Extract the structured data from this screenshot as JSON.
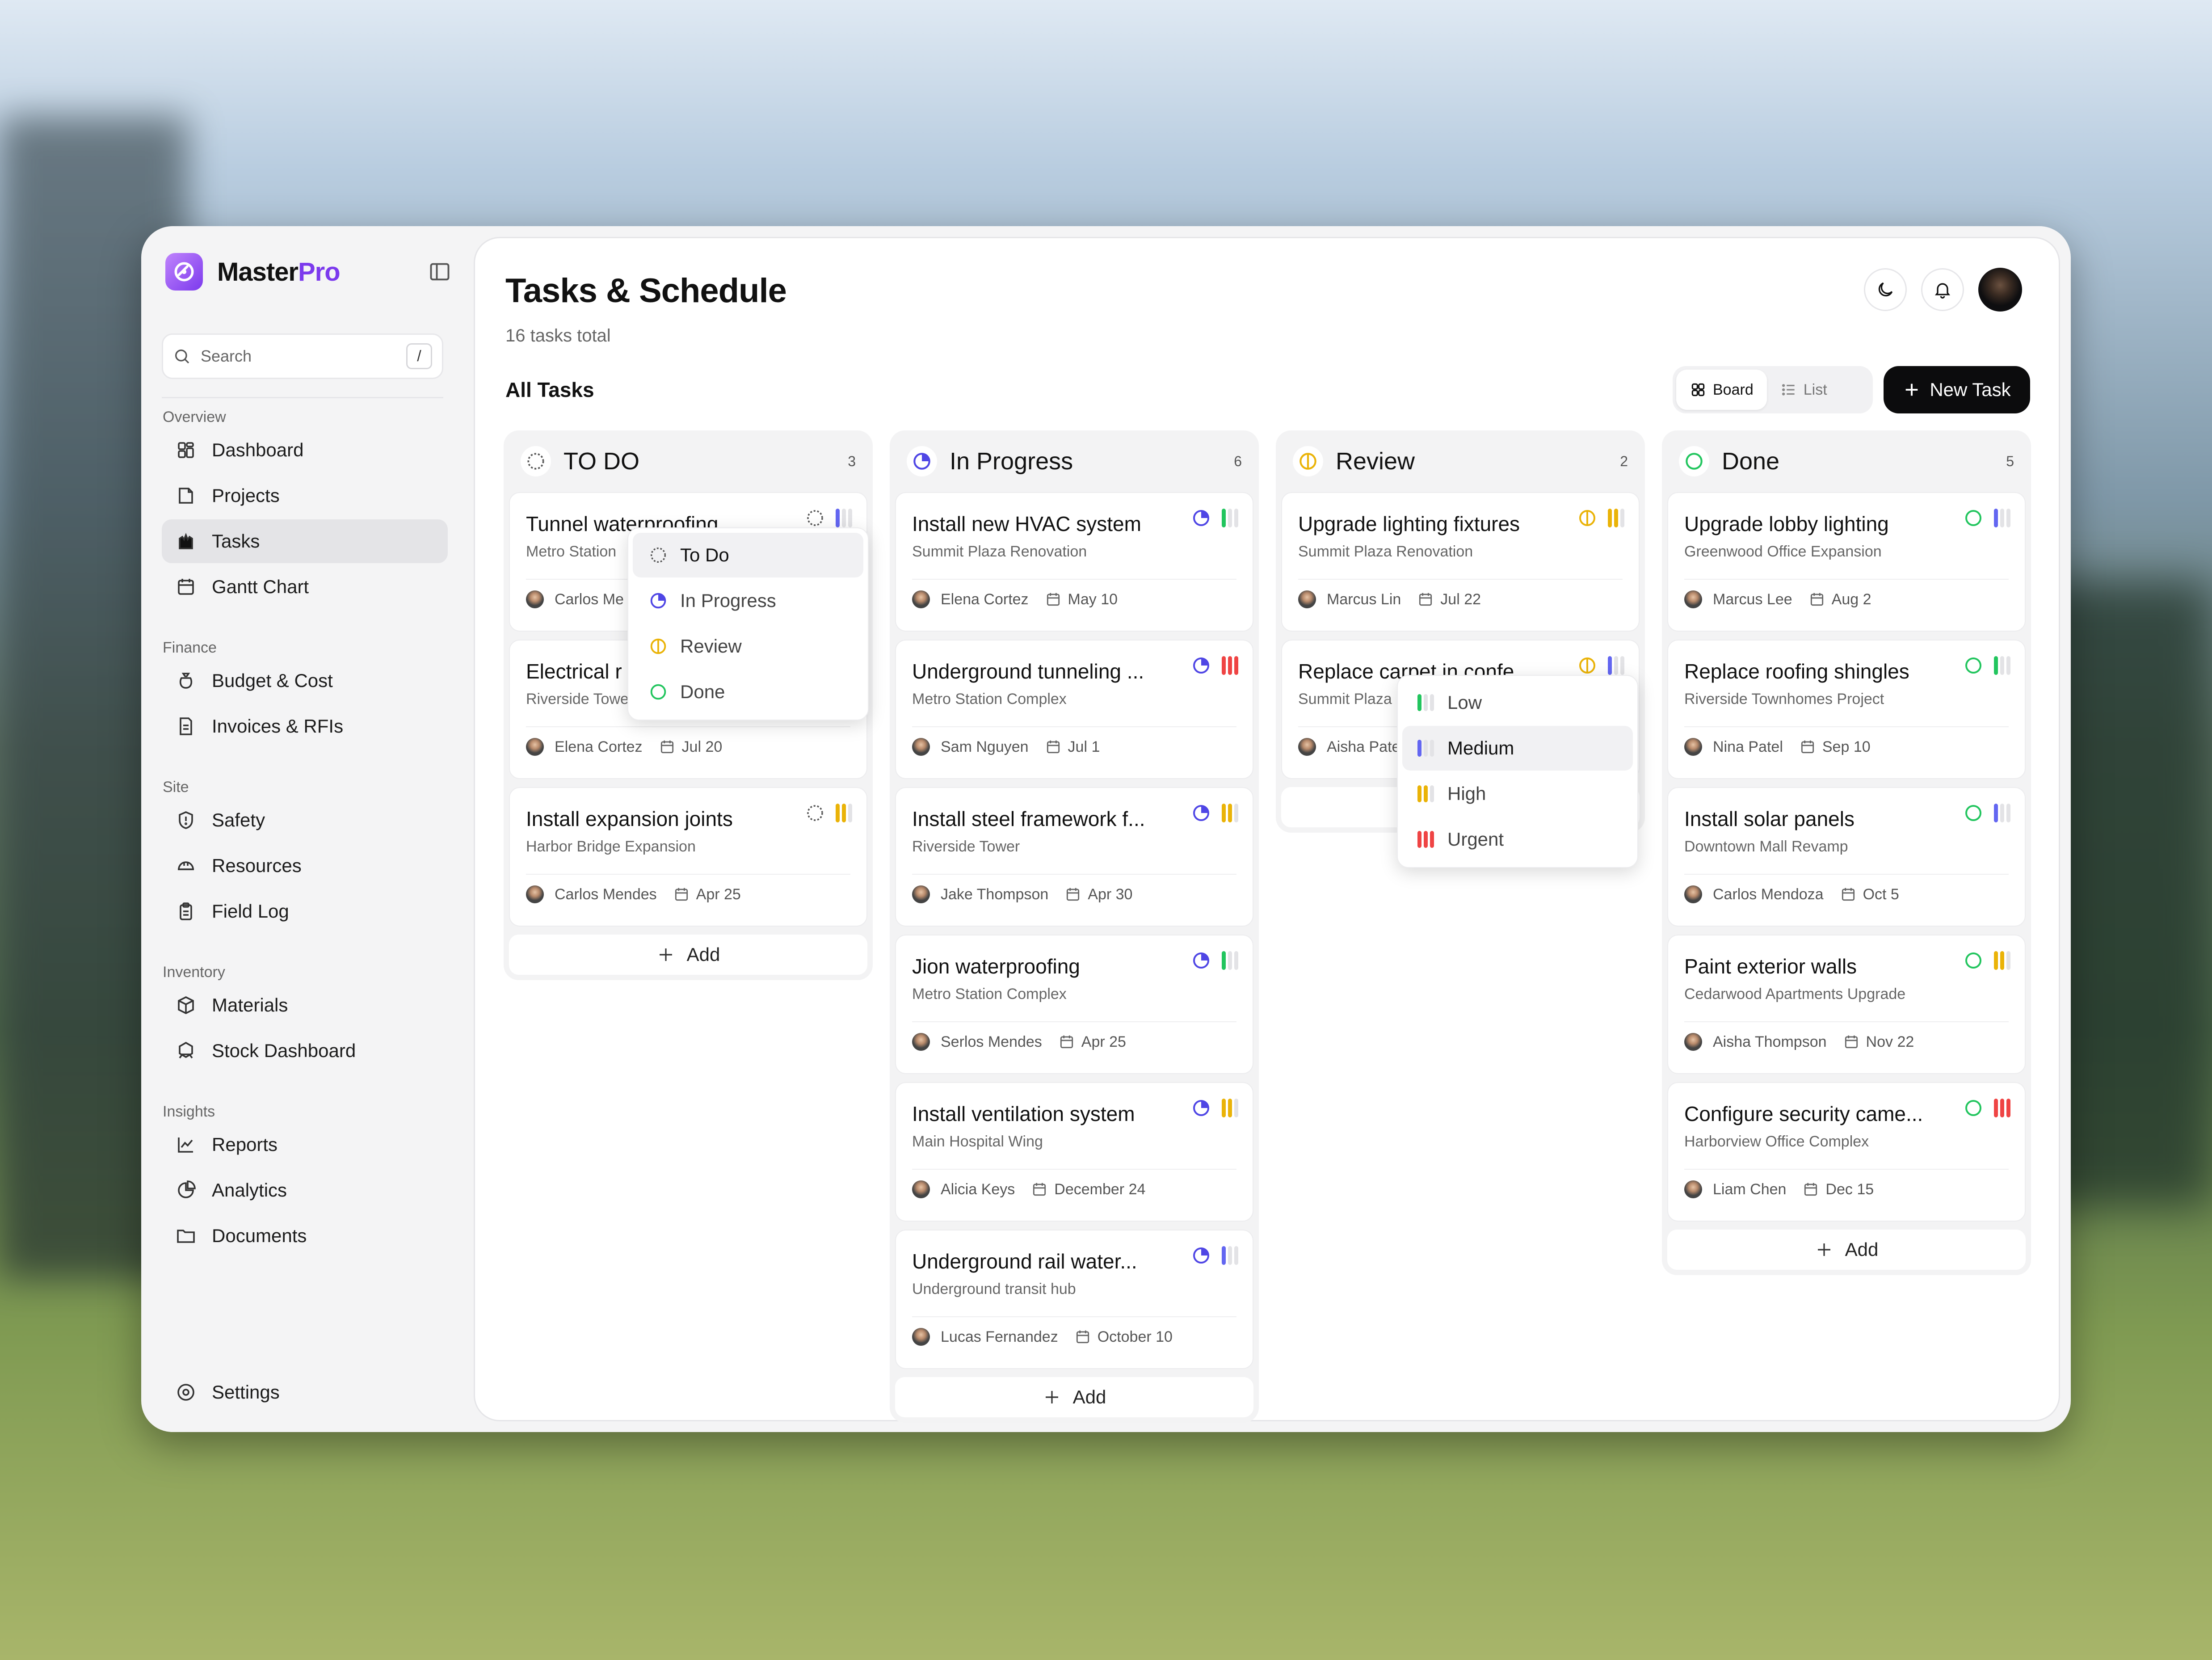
{
  "app": {
    "brand_main": "Master",
    "brand_accent": "Pro",
    "accent_color": "#7c3aed"
  },
  "search": {
    "placeholder": "Search",
    "shortcut": "/"
  },
  "nav": [
    {
      "section": "Overview",
      "items": [
        {
          "label": "Dashboard",
          "icon": "dashboard-icon"
        },
        {
          "label": "Projects",
          "icon": "projects-icon"
        },
        {
          "label": "Tasks",
          "icon": "tasks-icon",
          "active": true
        },
        {
          "label": "Gantt Chart",
          "icon": "calendar-icon"
        }
      ]
    },
    {
      "section": "Finance",
      "items": [
        {
          "label": "Budget & Cost",
          "icon": "money-bag-icon"
        },
        {
          "label": "Invoices & RFIs",
          "icon": "document-icon"
        }
      ]
    },
    {
      "section": "Site",
      "items": [
        {
          "label": "Safety",
          "icon": "shield-alert-icon"
        },
        {
          "label": "Resources",
          "icon": "helmet-icon"
        },
        {
          "label": "Field Log",
          "icon": "clipboard-icon"
        }
      ]
    },
    {
      "section": "Inventory",
      "items": [
        {
          "label": "Materials",
          "icon": "box-icon"
        },
        {
          "label": "Stock Dashboard",
          "icon": "stock-icon"
        }
      ]
    },
    {
      "section": "Insights",
      "items": [
        {
          "label": "Reports",
          "icon": "line-chart-icon"
        },
        {
          "label": "Analytics",
          "icon": "pie-chart-icon"
        },
        {
          "label": "Documents",
          "icon": "folder-icon"
        }
      ]
    }
  ],
  "settings_label": "Settings",
  "header": {
    "title": "Tasks & Schedule",
    "subtitle": "16 tasks total"
  },
  "toolbar": {
    "section_label": "All Tasks",
    "board_label": "Board",
    "list_label": "List",
    "new_task_label": "New Task"
  },
  "status_colors": {
    "todo": "#555555",
    "progress": "#4f46e5",
    "review": "#eab308",
    "done": "#22c55e"
  },
  "priority_colors": {
    "low": "#22c55e",
    "medium": "#6366f1",
    "high": "#eab308",
    "urgent": "#ef4444"
  },
  "add_label": "Add",
  "columns": [
    {
      "name": "TO DO",
      "status": "todo",
      "count": "3",
      "tasks": [
        {
          "title": "Tunnel waterproofing",
          "project": "Metro Station",
          "assignee": "Carlos Me",
          "date": "",
          "priority": "medium"
        },
        {
          "title": "Electrical r",
          "project": "Riverside Towe",
          "assignee": "Elena Cortez",
          "date": "Jul 20",
          "priority": ""
        },
        {
          "title": "Install expansion joints",
          "project": "Harbor Bridge Expansion",
          "assignee": "Carlos Mendes",
          "date": "Apr 25",
          "priority": "high"
        }
      ]
    },
    {
      "name": "In Progress",
      "status": "progress",
      "count": "6",
      "tasks": [
        {
          "title": "Install new HVAC system",
          "project": "Summit Plaza Renovation",
          "assignee": "Elena Cortez",
          "date": "May 10",
          "priority": "low"
        },
        {
          "title": "Underground tunneling ...",
          "project": "Metro Station Complex",
          "assignee": "Sam Nguyen",
          "date": "Jul 1",
          "priority": "urgent"
        },
        {
          "title": "Install steel framework f...",
          "project": "Riverside Tower",
          "assignee": "Jake Thompson",
          "date": "Apr 30",
          "priority": "high"
        },
        {
          "title": "Jion waterproofing",
          "project": "Metro Station Complex",
          "assignee": "Serlos Mendes",
          "date": "Apr 25",
          "priority": "low"
        },
        {
          "title": "Install ventilation system",
          "project": "Main Hospital Wing",
          "assignee": "Alicia Keys",
          "date": "December 24",
          "priority": "high"
        },
        {
          "title": "Underground rail water...",
          "project": "Underground transit hub",
          "assignee": "Lucas Fernandez",
          "date": "October 10",
          "priority": "medium"
        }
      ]
    },
    {
      "name": "Review",
      "status": "review",
      "count": "2",
      "tasks": [
        {
          "title": "Upgrade lighting fixtures",
          "project": "Summit Plaza Renovation",
          "assignee": "Marcus Lin",
          "date": "Jul 22",
          "priority": "high"
        },
        {
          "title": "Replace carpet in confe...",
          "project": "Summit Plaza",
          "assignee": "Aisha Pate",
          "date": "",
          "priority": "medium"
        }
      ]
    },
    {
      "name": "Done",
      "status": "done",
      "count": "5",
      "tasks": [
        {
          "title": "Upgrade lobby lighting",
          "project": "Greenwood Office Expansion",
          "assignee": "Marcus Lee",
          "date": "Aug 2",
          "priority": "medium"
        },
        {
          "title": "Replace roofing shingles",
          "project": "Riverside Townhomes Project",
          "assignee": "Nina Patel",
          "date": "Sep 10",
          "priority": "low"
        },
        {
          "title": "Install solar panels",
          "project": "Downtown Mall Revamp",
          "assignee": "Carlos Mendoza",
          "date": "Oct 5",
          "priority": "medium"
        },
        {
          "title": "Paint exterior walls",
          "project": "Cedarwood Apartments Upgrade",
          "assignee": "Aisha Thompson",
          "date": "Nov 22",
          "priority": "high"
        },
        {
          "title": "Configure security came...",
          "project": "Harborview Office Complex",
          "assignee": "Liam Chen",
          "date": "Dec 15",
          "priority": "urgent"
        }
      ]
    }
  ],
  "status_menu": {
    "items": [
      {
        "label": "To Do",
        "status": "todo",
        "selected": true
      },
      {
        "label": "In Progress",
        "status": "progress"
      },
      {
        "label": "Review",
        "status": "review"
      },
      {
        "label": "Done",
        "status": "done"
      }
    ]
  },
  "priority_menu": {
    "items": [
      {
        "label": "Low",
        "level": "low"
      },
      {
        "label": "Medium",
        "level": "medium",
        "selected": true
      },
      {
        "label": "High",
        "level": "high"
      },
      {
        "label": "Urgent",
        "level": "urgent"
      }
    ]
  }
}
